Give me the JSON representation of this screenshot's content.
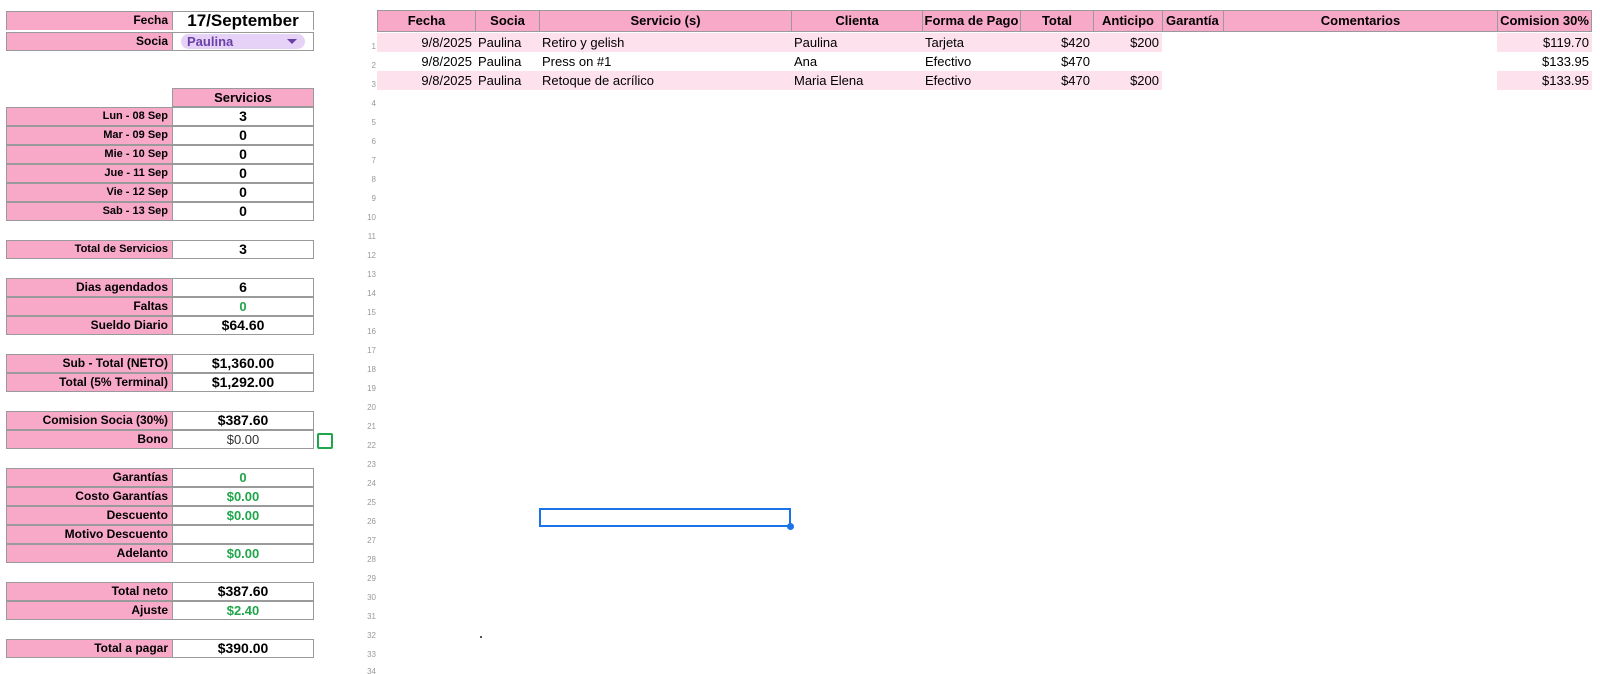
{
  "summary": {
    "fecha": {
      "label": "Fecha",
      "value": "17/September"
    },
    "socia": {
      "label": "Socia",
      "value": "Paulina"
    },
    "servicios_header": "Servicios",
    "days": [
      {
        "label": "Lun - 08 Sep",
        "value": "3"
      },
      {
        "label": "Mar - 09 Sep",
        "value": "0"
      },
      {
        "label": "Mie - 10 Sep",
        "value": "0"
      },
      {
        "label": "Jue - 11 Sep",
        "value": "0"
      },
      {
        "label": "Vie - 12 Sep",
        "value": "0"
      },
      {
        "label": "Sab - 13 Sep",
        "value": "0"
      }
    ],
    "total_servicios": {
      "label": "Total de Servicios",
      "value": "3"
    },
    "dias_agendados": {
      "label": "Dias agendados",
      "value": "6"
    },
    "faltas": {
      "label": "Faltas",
      "value": "0"
    },
    "sueldo_diario": {
      "label": "Sueldo Diario",
      "value": "$64.60"
    },
    "sub_total": {
      "label": "Sub - Total (NETO)",
      "value": "$1,360.00"
    },
    "total_terminal": {
      "label": "Total  (5% Terminal)",
      "value": "$1,292.00"
    },
    "comision_socia": {
      "label": "Comision Socia (30%)",
      "value": "$387.60"
    },
    "bono": {
      "label": "Bono",
      "value": "$0.00"
    },
    "garantias": {
      "label": "Garantías",
      "value": "0"
    },
    "costo_garantias": {
      "label": "Costo Garantías",
      "value": "$0.00"
    },
    "descuento": {
      "label": "Descuento",
      "value": "$0.00"
    },
    "motivo_descuento": {
      "label": "Motivo Descuento",
      "value": ""
    },
    "adelanto": {
      "label": "Adelanto",
      "value": "$0.00"
    },
    "total_neto": {
      "label": "Total neto",
      "value": "$387.60"
    },
    "ajuste": {
      "label": "Ajuste",
      "value": "$2.40"
    },
    "total_pagar": {
      "label": "Total a pagar",
      "value": "$390.00"
    }
  },
  "grid": {
    "headers": [
      "Fecha",
      "Socia",
      "Servicio (s)",
      "Clienta",
      "Forma de Pago",
      "Total",
      "Anticipo",
      "Garantía",
      "Comentarios",
      "Comision 30%"
    ],
    "rows": [
      {
        "fecha": "9/8/2025",
        "socia": "Paulina",
        "servicio": "Retiro y gelish",
        "clienta": "Paulina",
        "pago": "Tarjeta",
        "total": "$420",
        "anticipo": "$200",
        "garantia": "",
        "comentarios": "",
        "comision": "$119.70"
      },
      {
        "fecha": "9/8/2025",
        "socia": "Paulina",
        "servicio": "Press on #1",
        "clienta": "Ana",
        "pago": "Efectivo",
        "total": "$470",
        "anticipo": "",
        "garantia": "",
        "comentarios": "",
        "comision": "$133.95"
      },
      {
        "fecha": "9/8/2025",
        "socia": "Paulina",
        "servicio": "Retoque de acrílico",
        "clienta": "Maria Elena",
        "pago": "Efectivo",
        "total": "$470",
        "anticipo": "$200",
        "garantia": "",
        "comentarios": "",
        "comision": "$133.95"
      }
    ],
    "row_numbers": [
      "1",
      "2",
      "3",
      "4",
      "5",
      "6",
      "7",
      "8",
      "9",
      "10",
      "11",
      "12",
      "13",
      "14",
      "15",
      "16",
      "17",
      "18",
      "19",
      "20",
      "21",
      "22",
      "23",
      "24",
      "25",
      "26",
      "27",
      "28",
      "29",
      "30",
      "31",
      "32",
      "33",
      "34"
    ]
  },
  "colors": {
    "header_pink": "#f8a9c8",
    "band_pink": "#fde1ec",
    "positive_green": "#1fa54a",
    "selection_blue": "#1a73e8",
    "chip_purple": "#e6d2f7"
  },
  "icons": {
    "dropdown": "chevron-down-icon",
    "checkbox": "checkbox-icon"
  }
}
